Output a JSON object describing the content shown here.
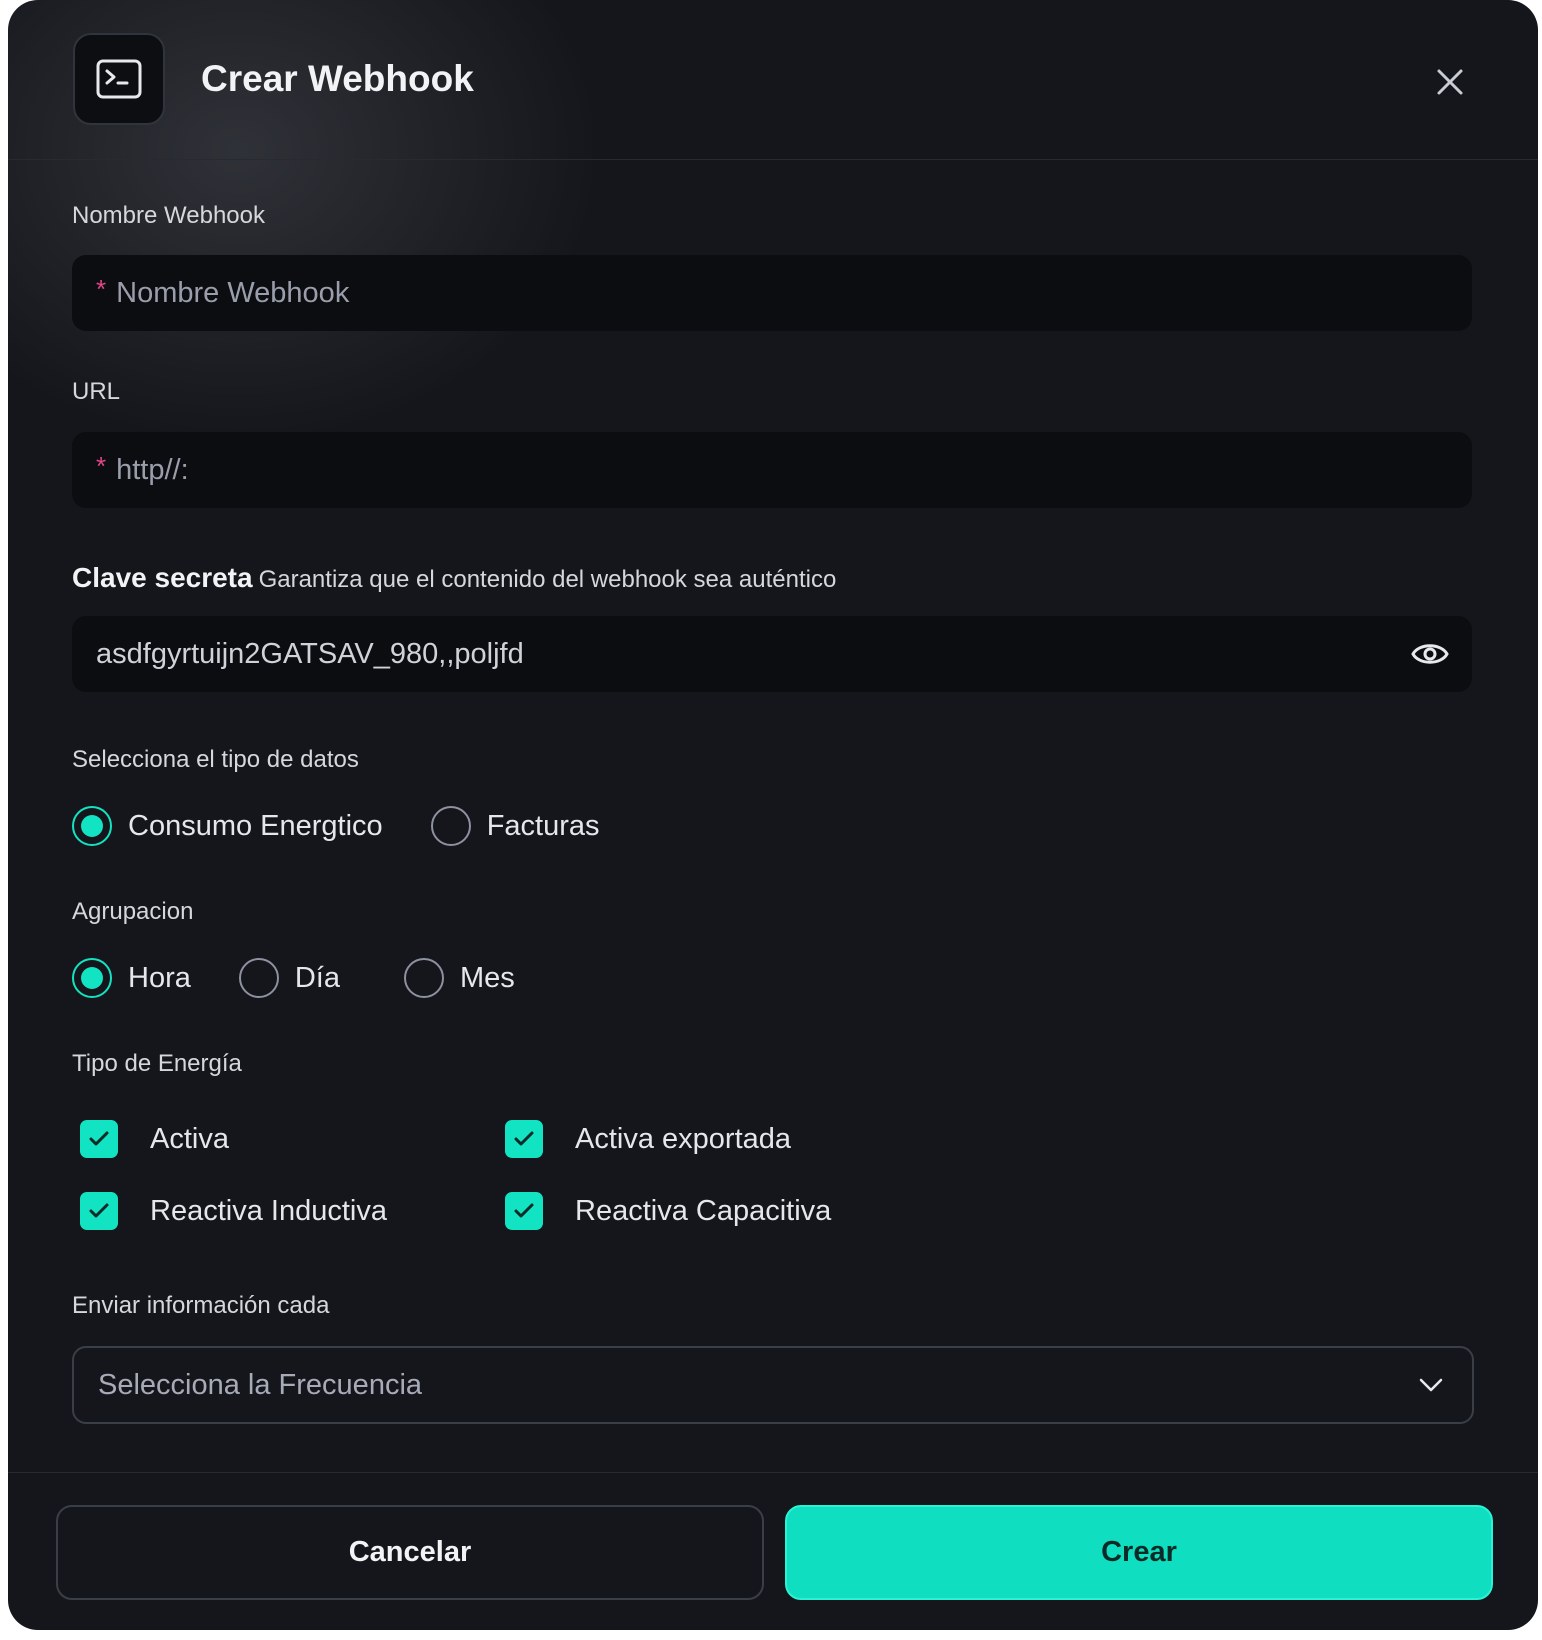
{
  "header": {
    "title": "Crear Webhook",
    "icon": "terminal-icon"
  },
  "fields": {
    "name": {
      "label": "Nombre Webhook",
      "placeholder": "Nombre Webhook",
      "required_mark": "*"
    },
    "url": {
      "label": "URL",
      "placeholder": "http//:",
      "required_mark": "*"
    },
    "secret": {
      "label": "Clave secreta",
      "hint": "Garantiza que el contenido del webhook sea auténtico",
      "value": "asdfgyrtuijn2GATSAV_980,,poljfd"
    }
  },
  "data_type": {
    "label": "Selecciona el tipo de datos",
    "options": [
      {
        "label": "Consumo Energtico",
        "checked": true
      },
      {
        "label": "Facturas",
        "checked": false
      }
    ]
  },
  "grouping": {
    "label": "Agrupacion",
    "options": [
      {
        "label": "Hora",
        "checked": true
      },
      {
        "label": "Día",
        "checked": false
      },
      {
        "label": "Mes",
        "checked": false
      }
    ]
  },
  "energy_type": {
    "label": "Tipo de Energía",
    "options": [
      {
        "label": "Activa",
        "checked": true
      },
      {
        "label": "Activa exportada",
        "checked": true
      },
      {
        "label": "Reactiva Inductiva",
        "checked": true
      },
      {
        "label": "Reactiva Capacitiva",
        "checked": true
      }
    ]
  },
  "frequency": {
    "label": "Enviar información cada",
    "placeholder": "Selecciona la Frecuencia"
  },
  "footer": {
    "cancel_label": "Cancelar",
    "create_label": "Crear"
  },
  "colors": {
    "accent": "#12e3c2",
    "background": "#14161b",
    "field": "#0b0d10",
    "required": "#e0468a"
  }
}
